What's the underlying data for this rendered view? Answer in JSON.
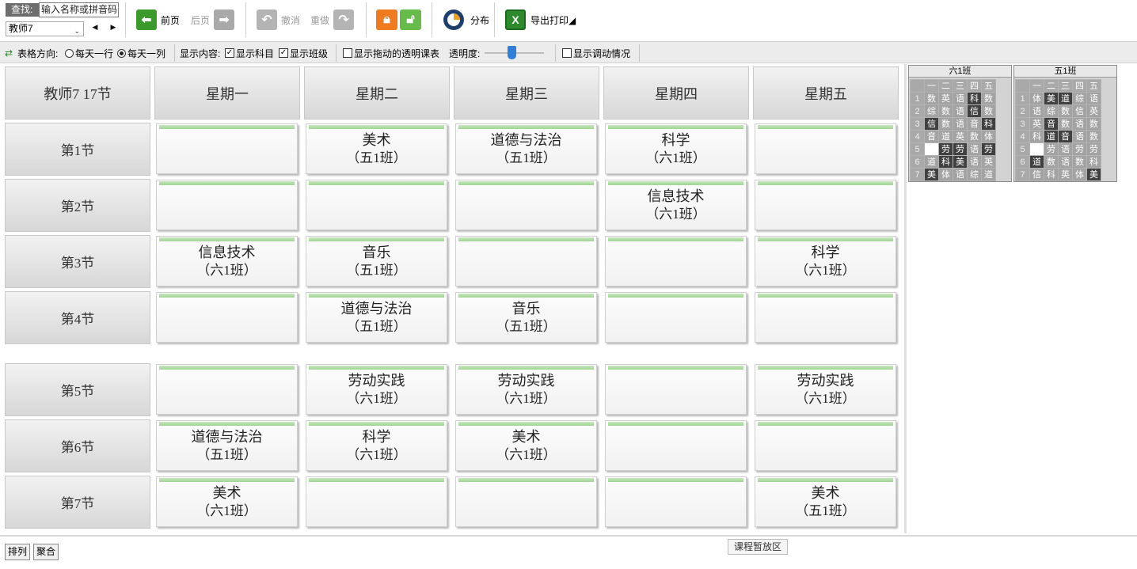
{
  "toolbar": {
    "search_label": "查找:",
    "search_placeholder": "输入名称或拼音码",
    "teacher_selected": "教师7",
    "prev_page": "前页",
    "next_page": "后页",
    "undo": "撤消",
    "redo": "重做",
    "distribute": "分布",
    "export_print": "导出打印◢"
  },
  "options": {
    "orientation_label": "表格方向:",
    "per_day_row": "每天一行",
    "per_day_col": "每天一列",
    "per_day_col_checked": true,
    "show_content_label": "显示内容:",
    "show_subject": "显示科目",
    "show_class": "显示班级",
    "show_drag_transparent": "显示拖动的透明课表",
    "opacity_label": "透明度:",
    "opacity_value": 0.45,
    "show_adjust": "显示调动情况"
  },
  "schedule": {
    "corner": "教师7 17节",
    "days": [
      "星期一",
      "星期二",
      "星期三",
      "星期四",
      "星期五"
    ],
    "periods": [
      "第1节",
      "第2节",
      "第3节",
      "第4节",
      "第5节",
      "第6节",
      "第7节"
    ],
    "cells": [
      [
        {
          "s": "",
          "c": ""
        },
        {
          "s": "美术",
          "c": "（五1班）"
        },
        {
          "s": "道德与法治",
          "c": "（五1班）"
        },
        {
          "s": "科学",
          "c": "（六1班）"
        },
        {
          "s": "",
          "c": ""
        }
      ],
      [
        {
          "s": "",
          "c": ""
        },
        {
          "s": "",
          "c": ""
        },
        {
          "s": "",
          "c": ""
        },
        {
          "s": "信息技术",
          "c": "（六1班）"
        },
        {
          "s": "",
          "c": ""
        }
      ],
      [
        {
          "s": "信息技术",
          "c": "（六1班）"
        },
        {
          "s": "音乐",
          "c": "（五1班）"
        },
        {
          "s": "",
          "c": ""
        },
        {
          "s": "",
          "c": ""
        },
        {
          "s": "科学",
          "c": "（六1班）"
        }
      ],
      [
        {
          "s": "",
          "c": ""
        },
        {
          "s": "道德与法治",
          "c": "（五1班）"
        },
        {
          "s": "音乐",
          "c": "（五1班）"
        },
        {
          "s": "",
          "c": ""
        },
        {
          "s": "",
          "c": ""
        }
      ],
      [
        {
          "s": "",
          "c": ""
        },
        {
          "s": "劳动实践",
          "c": "（六1班）"
        },
        {
          "s": "劳动实践",
          "c": "（六1班）"
        },
        {
          "s": "",
          "c": ""
        },
        {
          "s": "劳动实践",
          "c": "（六1班）"
        }
      ],
      [
        {
          "s": "道德与法治",
          "c": "（五1班）"
        },
        {
          "s": "科学",
          "c": "（六1班）"
        },
        {
          "s": "美术",
          "c": "（六1班）"
        },
        {
          "s": "",
          "c": ""
        },
        {
          "s": "",
          "c": ""
        }
      ],
      [
        {
          "s": "美术",
          "c": "（六1班）"
        },
        {
          "s": "",
          "c": ""
        },
        {
          "s": "",
          "c": ""
        },
        {
          "s": "",
          "c": ""
        },
        {
          "s": "美术",
          "c": "（五1班）"
        }
      ]
    ]
  },
  "mini_tables": [
    {
      "title": "六1班",
      "headers": [
        "",
        "一",
        "二",
        "三",
        "四",
        "五"
      ],
      "rows": [
        {
          "n": "1",
          "v": [
            "数",
            "英",
            "语",
            "科",
            "数"
          ],
          "dark": [
            false,
            false,
            false,
            true,
            false
          ]
        },
        {
          "n": "2",
          "v": [
            "综",
            "数",
            "语",
            "信",
            "数"
          ],
          "dark": [
            false,
            false,
            false,
            true,
            false
          ]
        },
        {
          "n": "3",
          "v": [
            "信",
            "数",
            "语",
            "音",
            "科"
          ],
          "dark": [
            true,
            false,
            false,
            false,
            true
          ]
        },
        {
          "n": "4",
          "v": [
            "音",
            "道",
            "英",
            "数",
            "体"
          ],
          "dark": [
            false,
            false,
            false,
            false,
            false
          ]
        },
        {
          "n": "5",
          "v": [
            "",
            "劳",
            "劳",
            "语",
            "劳"
          ],
          "dark": [
            false,
            true,
            true,
            false,
            true
          ],
          "white": [
            true,
            false,
            false,
            false,
            false
          ]
        },
        {
          "n": "6",
          "v": [
            "道",
            "科",
            "美",
            "语",
            "英"
          ],
          "dark": [
            false,
            true,
            true,
            false,
            false
          ]
        },
        {
          "n": "7",
          "v": [
            "美",
            "体",
            "语",
            "综",
            "道"
          ],
          "dark": [
            true,
            false,
            false,
            false,
            false
          ]
        }
      ]
    },
    {
      "title": "五1班",
      "headers": [
        "",
        "一",
        "二",
        "三",
        "四",
        "五"
      ],
      "rows": [
        {
          "n": "1",
          "v": [
            "体",
            "美",
            "道",
            "综",
            "语"
          ],
          "dark": [
            false,
            true,
            true,
            false,
            false
          ]
        },
        {
          "n": "2",
          "v": [
            "语",
            "综",
            "数",
            "信",
            "英"
          ],
          "dark": [
            false,
            false,
            false,
            false,
            false
          ]
        },
        {
          "n": "3",
          "v": [
            "英",
            "音",
            "数",
            "语",
            "数"
          ],
          "dark": [
            false,
            true,
            false,
            false,
            false
          ]
        },
        {
          "n": "4",
          "v": [
            "科",
            "道",
            "音",
            "语",
            "数"
          ],
          "dark": [
            false,
            true,
            true,
            false,
            false
          ]
        },
        {
          "n": "5",
          "v": [
            "",
            "劳",
            "语",
            "劳",
            "劳"
          ],
          "dark": [
            false,
            false,
            false,
            false,
            false
          ],
          "white": [
            true,
            false,
            false,
            false,
            false
          ]
        },
        {
          "n": "6",
          "v": [
            "道",
            "数",
            "语",
            "数",
            "科"
          ],
          "dark": [
            true,
            false,
            false,
            false,
            false
          ]
        },
        {
          "n": "7",
          "v": [
            "信",
            "科",
            "英",
            "体",
            "美"
          ],
          "dark": [
            false,
            false,
            false,
            false,
            true
          ]
        }
      ]
    }
  ],
  "bottom": {
    "arrange": "排列",
    "aggregate": "聚合",
    "stash_area": "课程暂放区"
  },
  "colors": {
    "accent_green": "#3c9a2c",
    "accent_orange": "#f07b1f",
    "cell_bar": "#9fd593",
    "mini_dark": "#404040"
  }
}
